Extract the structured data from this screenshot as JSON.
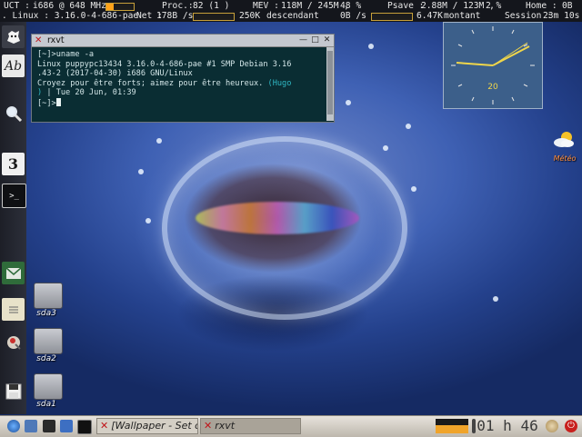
{
  "statusbar": {
    "uct_label": "UCT :",
    "cpu": "i686 @ 648 MHz",
    "cpu_load": 0.25,
    "proc_label": "Proc.:",
    "proc_value": "82  (1  )",
    "mev_label": "MEV :",
    "mev_value": "118M / 245M ,",
    "mev_pct": "48 %",
    "psave_label": "Psave :",
    "psave_value": "2.88M / 123M ,",
    "psave_pct": "2 %",
    "home_label": "Home :",
    "home_value": "0B",
    "kernel": ". Linux : 3.16.0-4-686-pae",
    "net_label": "Net :",
    "net_value": "178B /s",
    "down_value": "250K",
    "down_label": "descendant",
    "up_value": "0B /s",
    "up_total": "6.47K",
    "up_label": "montant",
    "session_label": "Session :",
    "session_value": "23m 10s"
  },
  "terminal": {
    "title": "rxvt",
    "lines": [
      "[~]>uname -a",
      "Linux puppypc13434 3.16.0-4-686-pae #1 SMP Debian 3.16",
      ".43-2 (2017-04-30) i686 GNU/Linux",
      "Croyez pour être forts; aimez pour être heureux."
    ],
    "quote_author_a": " (Hugo",
    "quote_author_b": ")",
    "date_line": " | Tue 20 Jun, 01:39",
    "prompt": "[~]>"
  },
  "clock_widget": {
    "date": "20"
  },
  "desktop": {
    "drives": [
      "sda3",
      "sda2",
      "sda1"
    ],
    "weather_label": "Météo"
  },
  "dock": {
    "items": [
      "puppy-logo",
      "abiword",
      "search",
      "puppy-3",
      "terminal",
      "mail",
      "notes",
      "paint",
      "floppy"
    ]
  },
  "taskbar": {
    "tasks": [
      "[Wallpaper - Set c",
      "rxvt"
    ],
    "clock": "01 h 46"
  },
  "colors": {
    "accent": "#ffa31a",
    "terminal_bg": "#0a2d33",
    "clock_bg": "#3c5f8a"
  }
}
